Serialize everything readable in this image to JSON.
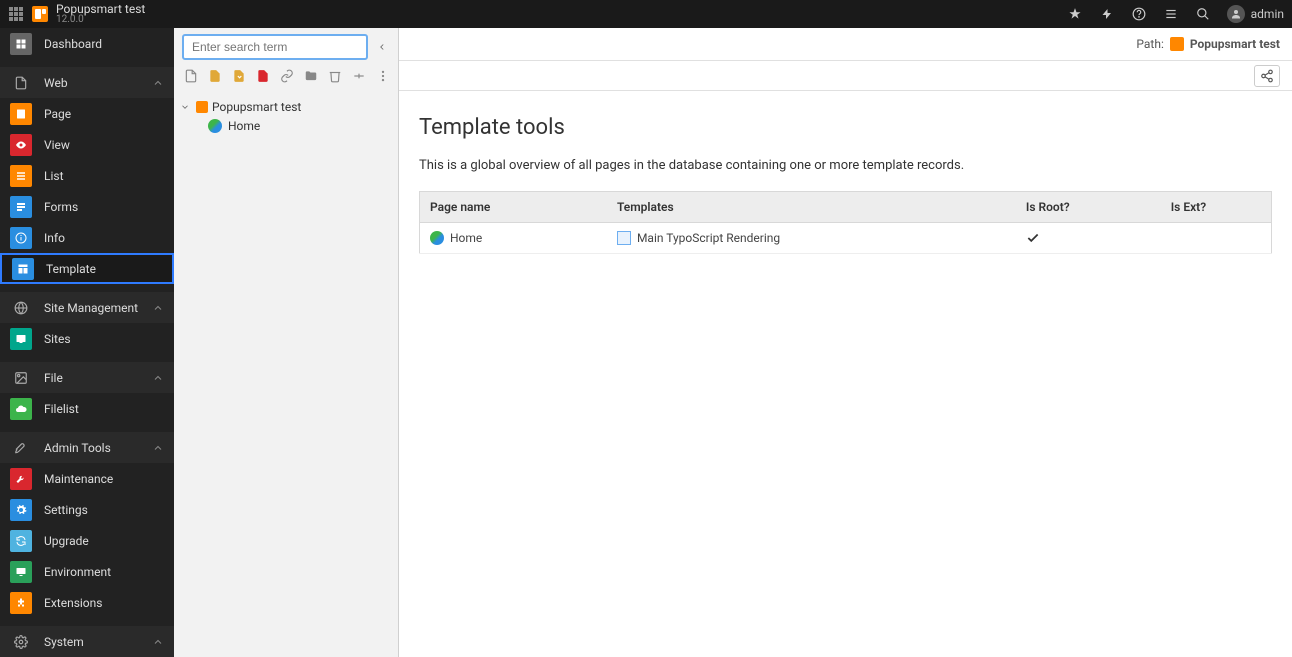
{
  "topbar": {
    "site_title": "Popupsmart test",
    "version": "12.0.0",
    "user": "admin"
  },
  "sidebar": {
    "dashboard": "Dashboard",
    "groups": [
      {
        "label": "Web",
        "items": [
          "Page",
          "View",
          "List",
          "Forms",
          "Info",
          "Template"
        ]
      },
      {
        "label": "Site Management",
        "items": [
          "Sites"
        ]
      },
      {
        "label": "File",
        "items": [
          "Filelist"
        ]
      },
      {
        "label": "Admin Tools",
        "items": [
          "Maintenance",
          "Settings",
          "Upgrade",
          "Environment",
          "Extensions"
        ]
      },
      {
        "label": "System",
        "items": []
      }
    ]
  },
  "tree": {
    "search_placeholder": "Enter search term",
    "root": "Popupsmart test",
    "nodes": [
      "Home"
    ]
  },
  "main": {
    "path_label": "Path:",
    "path_value": "Popupsmart test",
    "title": "Template tools",
    "intro": "This is a global overview of all pages in the database containing one or more template records.",
    "columns": {
      "page_name": "Page name",
      "templates": "Templates",
      "is_root": "Is Root?",
      "is_ext": "Is Ext?"
    },
    "rows": [
      {
        "page_name": "Home",
        "template": "Main TypoScript Rendering",
        "is_root": true,
        "is_ext": false
      }
    ]
  }
}
